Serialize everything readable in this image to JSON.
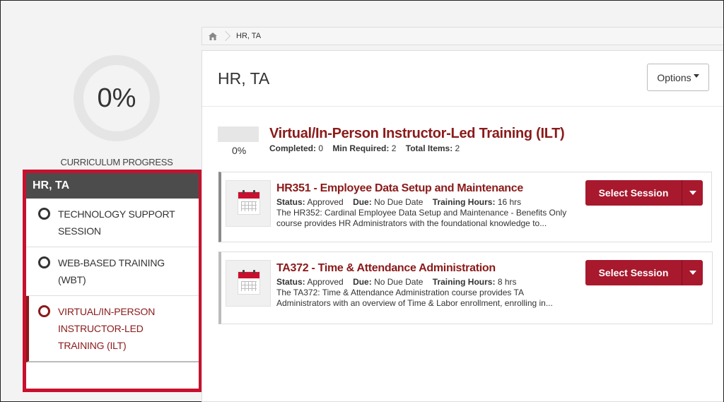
{
  "progress": {
    "value": "0%",
    "label": "CURRICULUM PROGRESS"
  },
  "sidebar": {
    "header": "HR, TA",
    "items": [
      {
        "label_line1": "TECHNOLOGY SUPPORT",
        "label_line2": "SESSION"
      },
      {
        "label_line1": "WEB-BASED TRAINING",
        "label_line2": "(WBT)"
      },
      {
        "label_line1": "VIRTUAL/IN-PERSON",
        "label_line2": "INSTRUCTOR-LED",
        "label_line3": "TRAINING (ILT)"
      }
    ]
  },
  "breadcrumb": {
    "current": "HR, TA"
  },
  "main": {
    "title": "HR, TA",
    "options_label": "Options",
    "section": {
      "percent": "0%",
      "title": "Virtual/In-Person Instructor-Led Training (ILT)",
      "completed_label": "Completed:",
      "completed_value": "0",
      "min_required_label": "Min Required:",
      "min_required_value": "2",
      "total_label": "Total Items:",
      "total_value": "2"
    },
    "courses": [
      {
        "title": "HR351 - Employee Data Setup and Maintenance",
        "status_label": "Status:",
        "status_value": "Approved",
        "due_label": "Due:",
        "due_value": "No Due Date",
        "hours_label": "Training Hours:",
        "hours_value": "16 hrs",
        "desc1": "The HR352: Cardinal Employee Data Setup and Maintenance - Benefits Only",
        "desc2": "course provides HR Administrators with the foundational knowledge to...",
        "button": "Select Session"
      },
      {
        "title": "TA372 - Time & Attendance Administration",
        "status_label": "Status:",
        "status_value": "Approved",
        "due_label": "Due:",
        "due_value": "No Due Date",
        "hours_label": "Training Hours:",
        "hours_value": "8 hrs",
        "desc1": "The TA372: Time & Attendance Administration course provides TA",
        "desc2": "Administrators with an overview of Time & Labor enrollment, enrolling in...",
        "button": "Select Session"
      }
    ]
  },
  "colors": {
    "accent": "#8b1a1a",
    "button": "#a8192e",
    "highlight_border": "#c8102e"
  },
  "icons": {
    "home": "home-icon",
    "calendar": "calendar-icon",
    "circle": "circle-icon",
    "caret": "caret-down-icon"
  }
}
